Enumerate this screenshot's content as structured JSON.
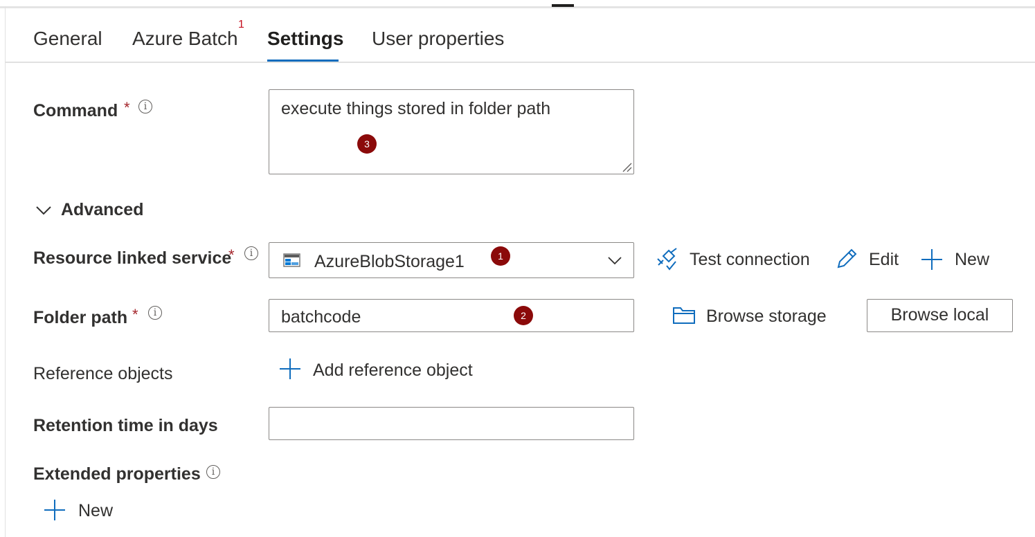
{
  "tabs": [
    {
      "label": "General"
    },
    {
      "label": "Azure Batch",
      "badge": "1"
    },
    {
      "label": "Settings"
    },
    {
      "label": "User properties"
    }
  ],
  "active_tab": "Settings",
  "required_marker": "*",
  "info_glyph": "i",
  "command": {
    "label": "Command",
    "value": "execute things stored in folder path",
    "annotation": "3"
  },
  "advanced": {
    "label": "Advanced",
    "expanded": true
  },
  "linked_service": {
    "label": "Resource linked service",
    "value": "AzureBlobStorage1",
    "annotation": "1",
    "test_connection_label": "Test connection",
    "edit_label": "Edit",
    "new_label": "New"
  },
  "folder_path": {
    "label": "Folder path",
    "value": "batchcode",
    "annotation": "2",
    "browse_storage_label": "Browse storage",
    "browse_local_label": "Browse local"
  },
  "reference_objects": {
    "label": "Reference objects",
    "add_label": "Add reference object"
  },
  "retention": {
    "label": "Retention time in days",
    "value": ""
  },
  "extended_properties": {
    "label": "Extended properties",
    "new_label": "New"
  },
  "colors": {
    "accent": "#0f6cbd",
    "required": "#a4262c",
    "annotation_badge": "#8b0a0a",
    "tab_badge": "#c50f1f"
  },
  "icons": {
    "linked_service": "azure-blob-storage-icon",
    "test_connection": "plug-connection-icon",
    "edit": "pencil-icon",
    "new": "plus-icon",
    "browse_storage": "folder-icon",
    "advanced": "chevron-down-icon"
  }
}
